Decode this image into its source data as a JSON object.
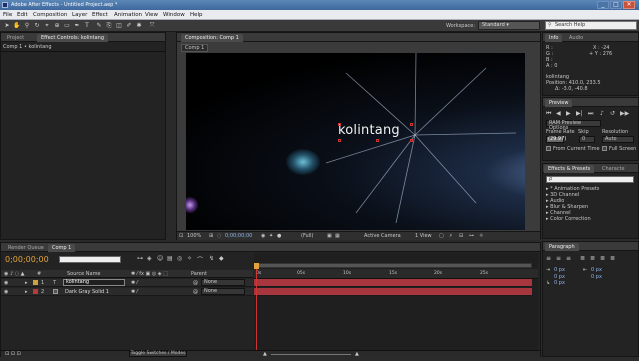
{
  "window": {
    "title": "Adobe After Effects - Untitled Project.aep *",
    "minimize": "_",
    "maximize": "□",
    "close": "✕"
  },
  "menu": [
    "File",
    "Edit",
    "Composition",
    "Layer",
    "Effect",
    "Animation",
    "View",
    "Window",
    "Help"
  ],
  "toolbar": {
    "workspace_label": "Workspace:",
    "workspace_value": "Standard",
    "search_placeholder": "Search Help"
  },
  "left_panel": {
    "tab_project": "Project",
    "tab_effect_controls": "Effect Controls: kolintang",
    "breadcrumb": "Comp 1 • kolintang"
  },
  "viewer": {
    "tab": "Composition: Comp 1",
    "comp_tab": "Comp 1",
    "text_layer": "kolintang",
    "zoom": "100%",
    "timecode": "0;00;00;00",
    "resolution": "(Full)",
    "camera": "Active Camera",
    "views": "1 View"
  },
  "info_panel": {
    "tab_info": "Info",
    "tab_audio": "Audio",
    "r": "R :",
    "g": "G :",
    "b": "B :",
    "a": "A : 0",
    "x": "X : -24",
    "y": "+ Y : 276",
    "layer_name": "kolintang",
    "position": "Position: 410.0, 233.5",
    "delta": "Δ: -3.0, -40.8"
  },
  "preview_panel": {
    "tab": "Preview",
    "ram_options": "RAM Preview Options",
    "frame_rate_label": "Frame Rate",
    "skip_label": "Skip",
    "resolution_label": "Resolution",
    "frame_rate_value": "(29.97)",
    "skip_value": "0",
    "resolution_value": "Auto",
    "from_current": "From Current Time",
    "full_screen": "Full Screen"
  },
  "effects_panel": {
    "tab_effects": "Effects & Presets",
    "tab_character": "Characte",
    "search_value": "ρ",
    "items": [
      "* Animation Presets",
      "3D Channel",
      "Audio",
      "Blur & Sharpen",
      "Channel",
      "Color Correction"
    ]
  },
  "paragraph_panel": {
    "tab": "Paragraph",
    "px1": "0 px",
    "px2": "0 px",
    "px3": "0 px",
    "px4": "0 px",
    "px5": "0 px"
  },
  "timeline": {
    "tab_render": "Render Queue",
    "tab_comp": "Comp 1",
    "timecode": "0;00;00;00",
    "col_source": "Source Name",
    "col_parent": "Parent",
    "ruler": [
      "0s",
      "05s",
      "10s",
      "15s",
      "20s",
      "25s"
    ],
    "layers": [
      {
        "num": "1",
        "name": "kolintang",
        "parent": "None"
      },
      {
        "num": "2",
        "name": "Dark Gray Solid 1",
        "parent": "None"
      }
    ],
    "toggle_label": "Toggle Switches / Modes"
  }
}
